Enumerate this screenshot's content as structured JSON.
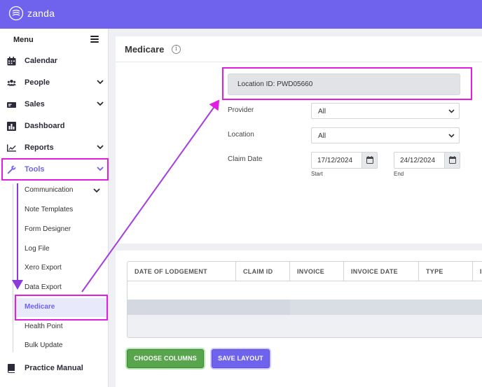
{
  "app": {
    "brand": "zanda",
    "accent": "#6f63ee",
    "highlight": "#e21fe0"
  },
  "sidebar": {
    "menu_label": "Menu",
    "items": [
      {
        "label": "Calendar",
        "icon": "calendar-icon",
        "has_chevron": false
      },
      {
        "label": "People",
        "icon": "users-icon",
        "has_chevron": true
      },
      {
        "label": "Sales",
        "icon": "money-icon",
        "has_chevron": true
      },
      {
        "label": "Dashboard",
        "icon": "dashboard-icon",
        "has_chevron": false
      },
      {
        "label": "Reports",
        "icon": "chart-icon",
        "has_chevron": true
      },
      {
        "label": "Tools",
        "icon": "wrench-icon",
        "has_chevron": true,
        "active": true
      }
    ],
    "tools_sub": [
      {
        "label": "Communication",
        "has_chevron": true
      },
      {
        "label": "Note Templates"
      },
      {
        "label": "Form Designer"
      },
      {
        "label": "Log File"
      },
      {
        "label": "Xero Export"
      },
      {
        "label": "Data Export"
      },
      {
        "label": "Medicare",
        "active": true
      },
      {
        "label": "Health Point"
      },
      {
        "label": "Bulk Update"
      }
    ],
    "bottom_item": {
      "label": "Practice Manual",
      "icon": "book-icon"
    }
  },
  "page": {
    "title": "Medicare",
    "location_id": "Location ID: PWD05660",
    "filters": {
      "provider_label": "Provider",
      "provider_value": "All",
      "location_label": "Location",
      "location_value": "All",
      "claim_date_label": "Claim Date",
      "start_date": "17/12/2024",
      "start_caption": "Start",
      "end_date": "24/12/2024",
      "end_caption": "End"
    }
  },
  "table": {
    "columns": [
      "DATE OF LODGEMENT",
      "CLAIM ID",
      "INVOICE",
      "INVOICE DATE",
      "TYPE",
      "I"
    ]
  },
  "actions": {
    "choose_columns": "CHOOSE COLUMNS",
    "save_layout": "SAVE LAYOUT"
  }
}
